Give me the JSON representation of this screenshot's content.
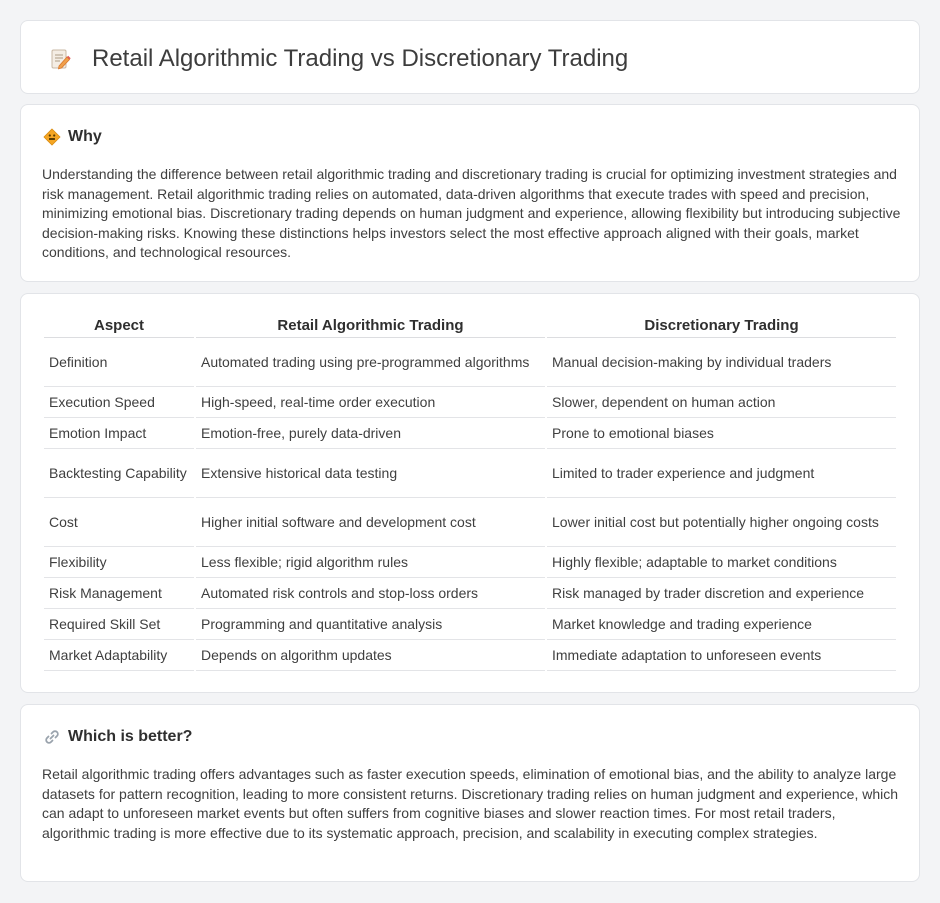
{
  "header": {
    "title": "Retail Algorithmic Trading vs Discretionary Trading",
    "icon": "document-edit-icon"
  },
  "why": {
    "title": "Why",
    "icon": "diamond-sign-icon",
    "text": "Understanding the difference between retail algorithmic trading and discretionary trading is crucial for optimizing investment strategies and risk management. Retail algorithmic trading relies on automated, data-driven algorithms that execute trades with speed and precision, minimizing emotional bias. Discretionary trading depends on human judgment and experience, allowing flexibility but introducing subjective decision-making risks. Knowing these distinctions helps investors select the most effective approach aligned with their goals, market conditions, and technological resources."
  },
  "table": {
    "headers": [
      "Aspect",
      "Retail Algorithmic Trading",
      "Discretionary Trading"
    ],
    "rows": [
      [
        "Definition",
        "Automated trading using pre-programmed algorithms",
        "Manual decision-making by individual traders"
      ],
      [
        "Execution Speed",
        "High-speed, real-time order execution",
        "Slower, dependent on human action"
      ],
      [
        "Emotion Impact",
        "Emotion-free, purely data-driven",
        "Prone to emotional biases"
      ],
      [
        "Backtesting Capability",
        "Extensive historical data testing",
        "Limited to trader experience and judgment"
      ],
      [
        "Cost",
        "Higher initial software and development cost",
        "Lower initial cost but potentially higher ongoing costs"
      ],
      [
        "Flexibility",
        "Less flexible; rigid algorithm rules",
        "Highly flexible; adaptable to market conditions"
      ],
      [
        "Risk Management",
        "Automated risk controls and stop-loss orders",
        "Risk managed by trader discretion and experience"
      ],
      [
        "Required Skill Set",
        "Programming and quantitative analysis",
        "Market knowledge and trading experience"
      ],
      [
        "Market Adaptability",
        "Depends on algorithm updates",
        "Immediate adaptation to unforeseen events"
      ]
    ]
  },
  "better": {
    "title": "Which is better?",
    "icon": "link-icon",
    "text": "Retail algorithmic trading offers advantages such as faster execution speeds, elimination of emotional bias, and the ability to analyze large datasets for pattern recognition, leading to more consistent returns. Discretionary trading relies on human judgment and experience, which can adapt to unforeseen market events but often suffers from cognitive biases and slower reaction times. For most retail traders, algorithmic trading is more effective due to its systematic approach, precision, and scalability in executing complex strategies."
  }
}
